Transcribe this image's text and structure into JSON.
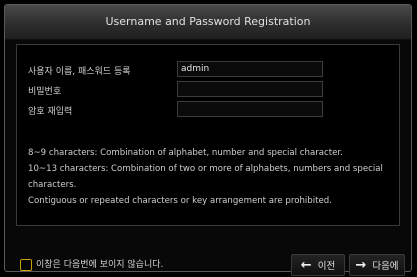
{
  "dialog": {
    "title": "Username and Password Registration"
  },
  "form": {
    "username": {
      "label": "사용자 이름, 패스워드 등록",
      "value": "admin"
    },
    "password": {
      "label": "비밀번호",
      "value": ""
    },
    "confirm": {
      "label": "암호 재입력",
      "value": ""
    }
  },
  "notes": [
    "8~9 characters: Combination of alphabet, number and special character.",
    "10~13 characters: Combination of two or more of alphabets, numbers and special",
    "characters.",
    "Contiguous or repeated characters or key arrangement are prohibited."
  ],
  "footer": {
    "dont_show_label": "이창은 다음번에 보이지 않습니다.",
    "prev_label": "이전",
    "next_label": "다음에",
    "prev_icon": "arrow-left-icon",
    "next_icon": "arrow-right-icon"
  },
  "colors": {
    "checkbox_border": "#c8a200"
  }
}
